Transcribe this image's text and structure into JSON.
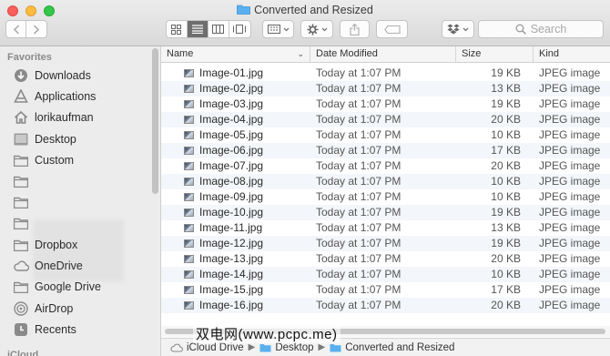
{
  "window": {
    "title": "Converted and Resized"
  },
  "toolbar": {
    "search_placeholder": "Search"
  },
  "sidebar": {
    "section_favorites": "Favorites",
    "items": [
      {
        "label": "Downloads",
        "icon": "download-icon"
      },
      {
        "label": "Applications",
        "icon": "applications-icon"
      },
      {
        "label": "lorikaufman",
        "icon": "home-icon"
      },
      {
        "label": "Desktop",
        "icon": "desktop-icon"
      },
      {
        "label": "Custom",
        "icon": "folder-icon"
      },
      {
        "label": "",
        "icon": "folder-icon"
      },
      {
        "label": "",
        "icon": "folder-icon"
      },
      {
        "label": "",
        "icon": "folder-icon"
      },
      {
        "label": "Dropbox",
        "icon": "folder-icon"
      },
      {
        "label": "OneDrive",
        "icon": "cloud-icon"
      },
      {
        "label": "Google Drive",
        "icon": "folder-icon"
      },
      {
        "label": "AirDrop",
        "icon": "airdrop-icon"
      },
      {
        "label": "Recents",
        "icon": "clock-icon"
      }
    ],
    "section_icloud": "iCloud"
  },
  "columns": {
    "name": "Name",
    "date": "Date Modified",
    "size": "Size",
    "kind": "Kind"
  },
  "files": [
    {
      "name": "Image-01.jpg",
      "date": "Today at 1:07 PM",
      "size": "19 KB",
      "kind": "JPEG image"
    },
    {
      "name": "Image-02.jpg",
      "date": "Today at 1:07 PM",
      "size": "13 KB",
      "kind": "JPEG image"
    },
    {
      "name": "Image-03.jpg",
      "date": "Today at 1:07 PM",
      "size": "19 KB",
      "kind": "JPEG image"
    },
    {
      "name": "Image-04.jpg",
      "date": "Today at 1:07 PM",
      "size": "20 KB",
      "kind": "JPEG image"
    },
    {
      "name": "Image-05.jpg",
      "date": "Today at 1:07 PM",
      "size": "10 KB",
      "kind": "JPEG image"
    },
    {
      "name": "Image-06.jpg",
      "date": "Today at 1:07 PM",
      "size": "17 KB",
      "kind": "JPEG image"
    },
    {
      "name": "Image-07.jpg",
      "date": "Today at 1:07 PM",
      "size": "20 KB",
      "kind": "JPEG image"
    },
    {
      "name": "Image-08.jpg",
      "date": "Today at 1:07 PM",
      "size": "10 KB",
      "kind": "JPEG image"
    },
    {
      "name": "Image-09.jpg",
      "date": "Today at 1:07 PM",
      "size": "10 KB",
      "kind": "JPEG image"
    },
    {
      "name": "Image-10.jpg",
      "date": "Today at 1:07 PM",
      "size": "19 KB",
      "kind": "JPEG image"
    },
    {
      "name": "Image-11.jpg",
      "date": "Today at 1:07 PM",
      "size": "13 KB",
      "kind": "JPEG image"
    },
    {
      "name": "Image-12.jpg",
      "date": "Today at 1:07 PM",
      "size": "19 KB",
      "kind": "JPEG image"
    },
    {
      "name": "Image-13.jpg",
      "date": "Today at 1:07 PM",
      "size": "20 KB",
      "kind": "JPEG image"
    },
    {
      "name": "Image-14.jpg",
      "date": "Today at 1:07 PM",
      "size": "10 KB",
      "kind": "JPEG image"
    },
    {
      "name": "Image-15.jpg",
      "date": "Today at 1:07 PM",
      "size": "17 KB",
      "kind": "JPEG image"
    },
    {
      "name": "Image-16.jpg",
      "date": "Today at 1:07 PM",
      "size": "20 KB",
      "kind": "JPEG image"
    }
  ],
  "pathbar": {
    "segments": [
      {
        "label": "iCloud Drive",
        "icon": "cloud-icon"
      },
      {
        "label": "Desktop",
        "icon": "folder-icon"
      },
      {
        "label": "Converted and Resized",
        "icon": "folder-icon"
      }
    ]
  },
  "watermark": "双电网(www.pcpc.me)",
  "colors": {
    "folder_blue": "#5ab0ef",
    "alt_row": "#f3f6fa",
    "sidebar_bg": "#ececec"
  }
}
